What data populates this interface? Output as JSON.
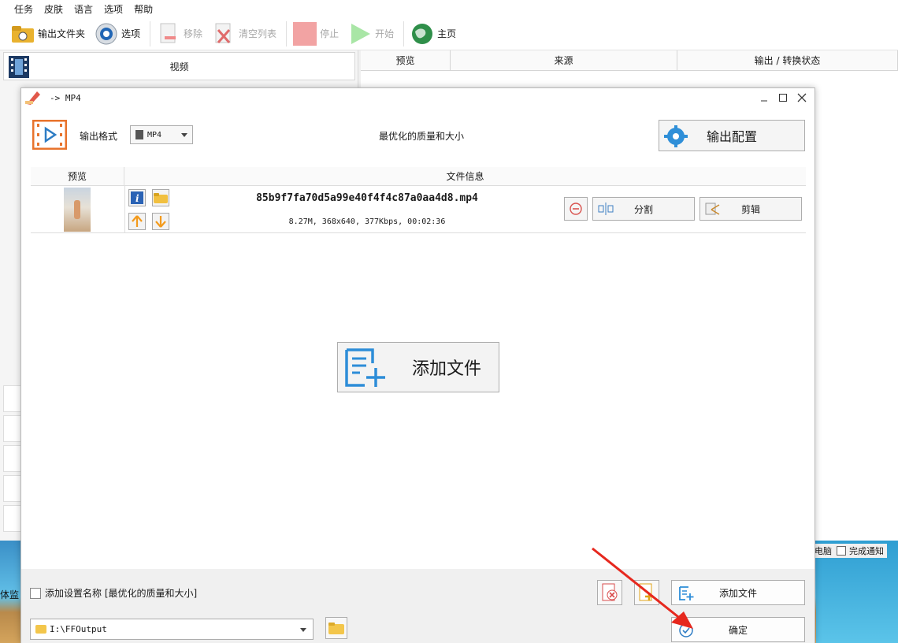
{
  "menu": [
    "任务",
    "皮肤",
    "语言",
    "选项",
    "帮助"
  ],
  "toolbar": {
    "output_folder": "输出文件夹",
    "options": "选项",
    "remove": "移除",
    "clear_list": "清空列表",
    "stop": "停止",
    "start": "开始",
    "home": "主页"
  },
  "left_panel": {
    "video_label": "视频"
  },
  "right_panel": {
    "columns": [
      "预览",
      "来源",
      "输出 / 转换状态"
    ]
  },
  "notify": {
    "pc_text": "电脑",
    "done_notify": "完成通知"
  },
  "desktop": {
    "partial_text": "体监"
  },
  "dialog": {
    "title": "-> MP4",
    "format_label": "输出格式",
    "format_value": "MP4",
    "quality_text": "最优化的质量和大小",
    "config_button": "输出配置",
    "columns": [
      "预览",
      "文件信息"
    ],
    "file": {
      "name": "85b9f7fa70d5a99e40f4f4c87a0aa4d8.mp4",
      "info": "8.27M, 368x640, 377Kbps, 00:02:36",
      "split_label": "分割",
      "trim_label": "剪辑"
    },
    "add_file_big": "添加文件",
    "footer": {
      "add_setting_name": "添加设置名称 [最优化的质量和大小]",
      "add_file": "添加文件",
      "output_path": "I:\\FFOutput",
      "ok": "确定"
    }
  },
  "colors": {
    "accent_orange": "#e8732c",
    "accent_blue": "#2d7cc4",
    "red_arrow": "#e6281e"
  }
}
